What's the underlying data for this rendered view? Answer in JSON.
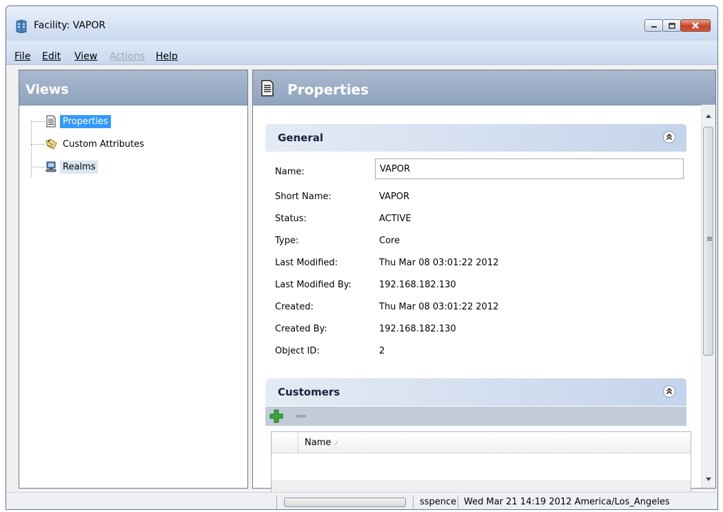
{
  "window": {
    "title": "Facility: VAPOR"
  },
  "menu": [
    {
      "label": "File",
      "enabled": true
    },
    {
      "label": "Edit",
      "enabled": true
    },
    {
      "label": "View",
      "enabled": true
    },
    {
      "label": "Actions",
      "enabled": false
    },
    {
      "label": "Help",
      "enabled": true
    }
  ],
  "views": {
    "title": "Views",
    "items": [
      {
        "label": "Properties",
        "icon": "document-icon",
        "state": "selected"
      },
      {
        "label": "Custom Attributes",
        "icon": "tag-icon",
        "state": "normal"
      },
      {
        "label": "Realms",
        "icon": "computer-icon",
        "state": "hover"
      }
    ]
  },
  "properties": {
    "title": "Properties",
    "general": {
      "title": "General",
      "fields": [
        {
          "label": "Name:",
          "value": "VAPOR"
        },
        {
          "label": "Short Name:",
          "value": "VAPOR"
        },
        {
          "label": "Status:",
          "value": "ACTIVE"
        },
        {
          "label": "Type:",
          "value": "Core"
        },
        {
          "label": "Last Modified:",
          "value": "Thu Mar 08 03:01:22 2012"
        },
        {
          "label": "Last Modified By:",
          "value": "192.168.182.130"
        },
        {
          "label": "Created:",
          "value": "Thu Mar 08 03:01:22 2012"
        },
        {
          "label": "Created By:",
          "value": "192.168.182.130"
        },
        {
          "label": "Object ID:",
          "value": "2"
        }
      ]
    },
    "customers": {
      "title": "Customers",
      "columns": [
        "Name"
      ],
      "add_icon": "plus-icon",
      "remove_icon": "minus-icon"
    }
  },
  "status": {
    "progress": 0,
    "user": "sspence",
    "datetime": "Wed Mar 21 14:19 2012 America/Los_Angeles"
  },
  "colors": {
    "selection": "#3399ff",
    "pane_header": "#9aaec7",
    "add_green": "#3aa83a"
  }
}
